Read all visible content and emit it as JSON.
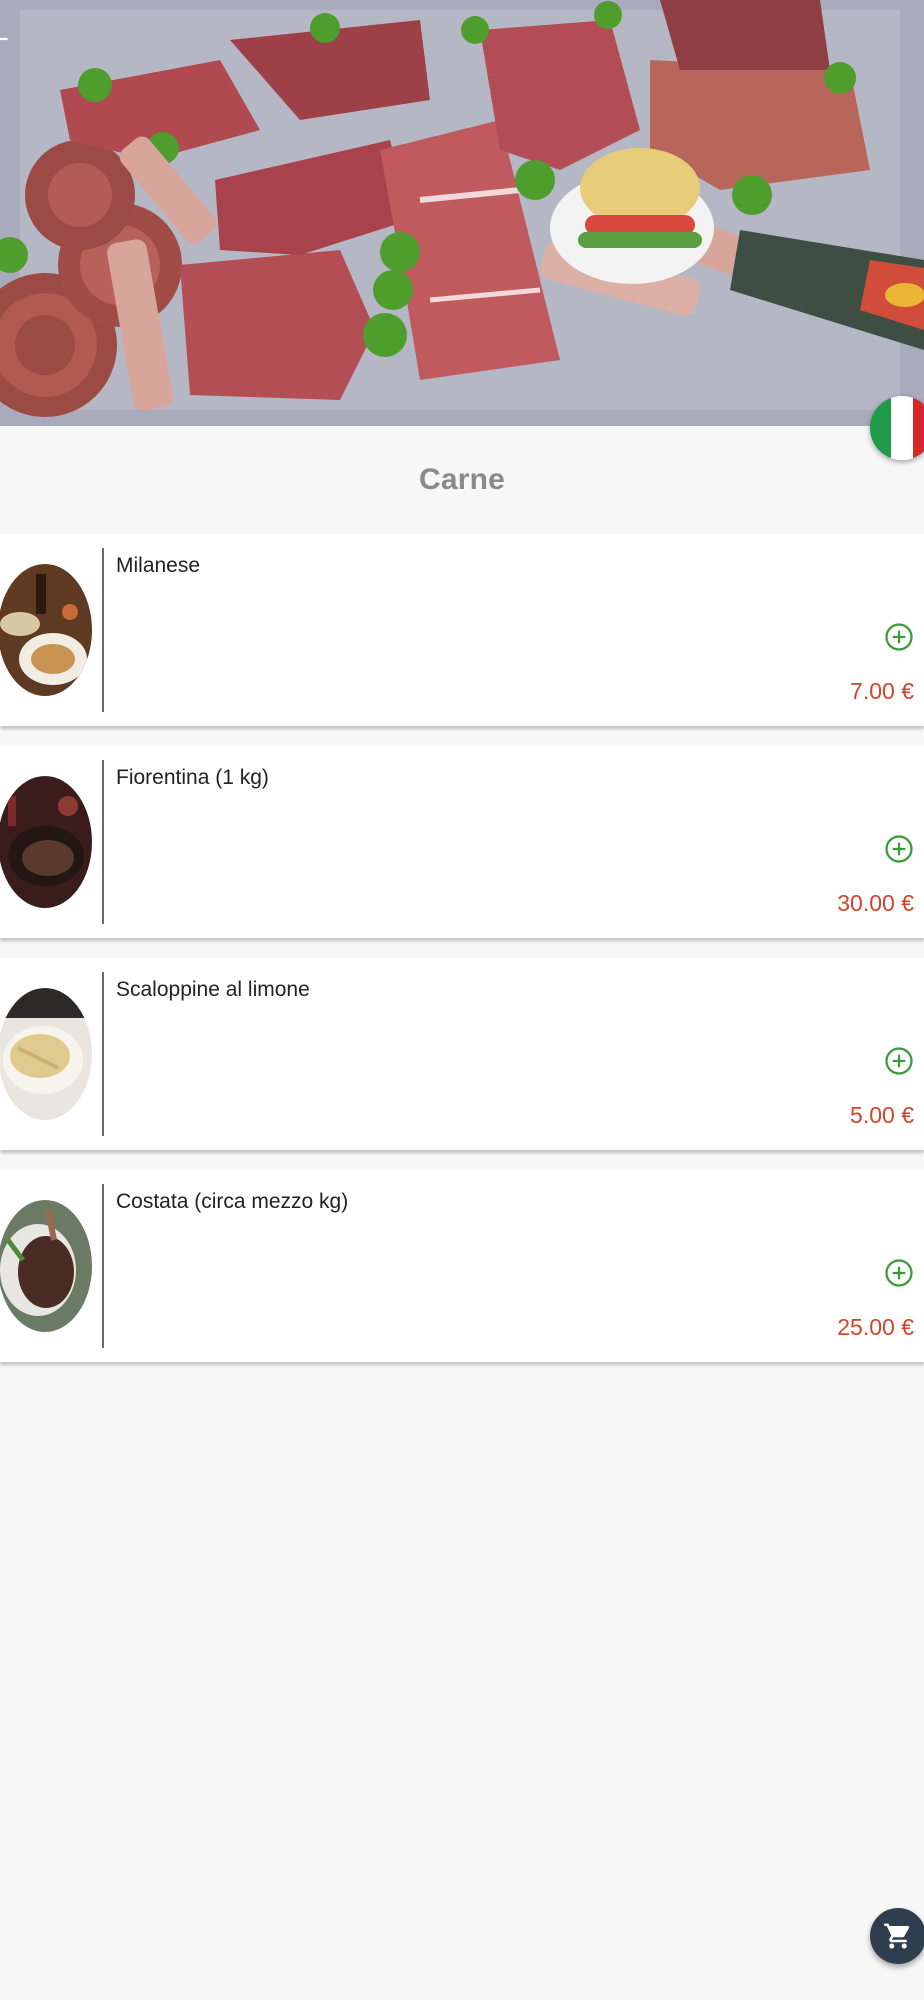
{
  "category": {
    "title": "Carne"
  },
  "language": {
    "flag_colors": [
      "#1f9a48",
      "#ffffff",
      "#d62828"
    ]
  },
  "items": [
    {
      "name": "Milanese",
      "price": "7.00 €"
    },
    {
      "name": "Fiorentina (1 kg)",
      "price": "30.00 €"
    },
    {
      "name": "Scaloppine al limone",
      "price": "5.00 €"
    },
    {
      "name": "Costata (circa mezzo kg)",
      "price": "25.00 €"
    }
  ],
  "colors": {
    "price": "#d2442a",
    "add_icon": "#3a9a3a",
    "cart_fab": "#2f3e4e"
  },
  "icons": {
    "back": "arrow-back-icon",
    "add": "add-circle-icon",
    "cart": "shopping-cart-icon"
  }
}
